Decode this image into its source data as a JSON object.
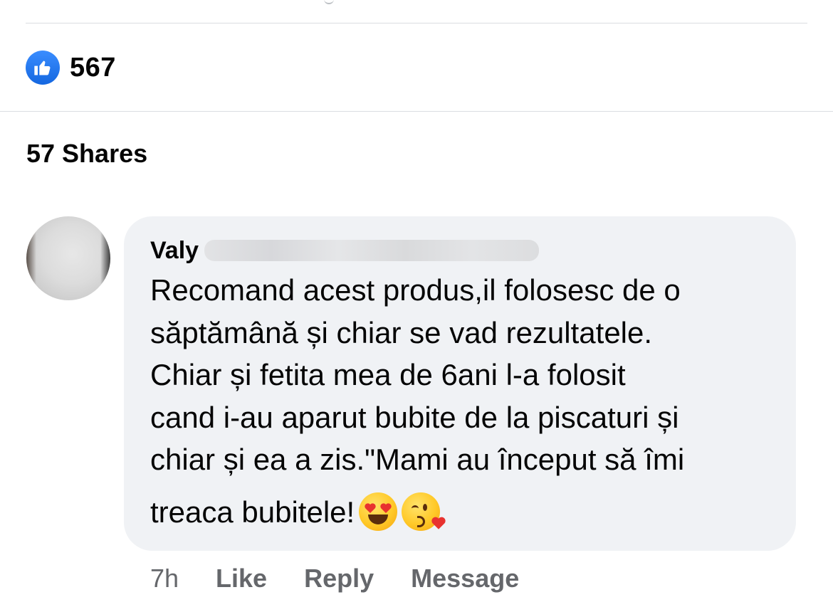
{
  "reactions": {
    "icon": "like-icon",
    "count": "567",
    "color": "#1877f2"
  },
  "shares": {
    "label": "57 Shares"
  },
  "comment": {
    "author_first_name": "Valy",
    "avatar": "user-avatar",
    "text_lines": [
      "Recomand acest produs,il folosesc de o",
      "săptămână și chiar se vad rezultatele.",
      "Chiar și fetita mea de 6ani l-a folosit",
      "cand i-au aparut bubite de la piscaturi și",
      "chiar și ea a zis.\"Mami au început să îmi",
      "treaca bubitele!"
    ],
    "emojis": [
      "heart-eyes-emoji",
      "face-blowing-kiss-emoji"
    ],
    "bubble_color": "#f0f2f5"
  },
  "actions": {
    "time": "7h",
    "like_label": "Like",
    "reply_label": "Reply",
    "message_label": "Message"
  }
}
